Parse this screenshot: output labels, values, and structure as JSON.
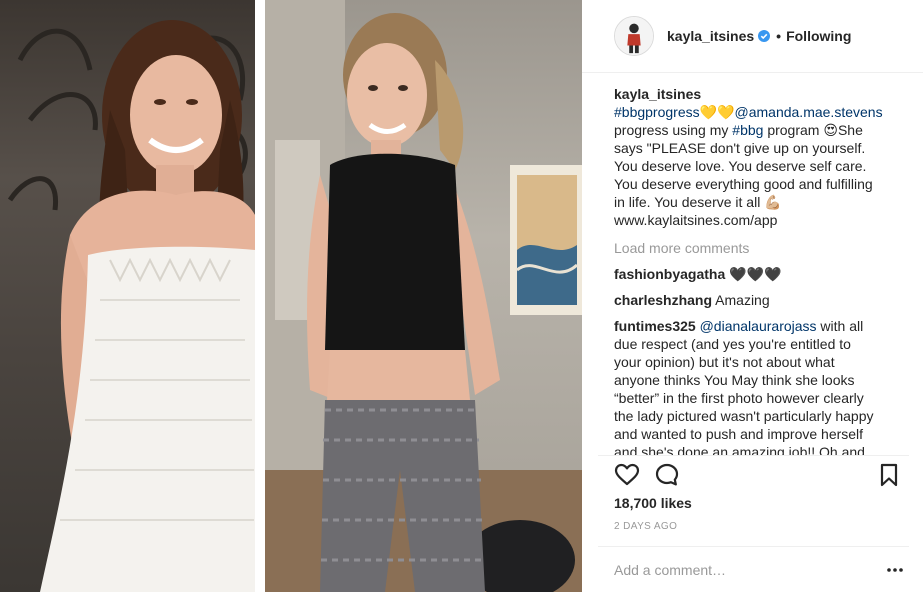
{
  "post": {
    "photo_left_alt": "",
    "photo_right_alt": ""
  },
  "header": {
    "username": "kayla_itsines",
    "separator": "•",
    "follow_label": "Following",
    "avatar_icon": "avatar-icon",
    "verified_icon": "verified-badge-icon"
  },
  "caption": {
    "username": "kayla_itsines",
    "line1_tag": "#bbgprogress",
    "line1_emoji": "💛💛",
    "line1_mention": "@amanda.mae.stevens",
    "line2_a": "progress using my ",
    "line2_tag": "#bbg",
    "line2_b": " program ",
    "line2_emoji": "😍",
    "line2_c": "She",
    "line3": "says \"PLEASE don't give up on yourself.",
    "line4": "You deserve love. You deserve self care.",
    "line5": "You deserve everything good and fulfilling",
    "line6_a": "in life. You deserve it all ",
    "line6_emoji": "💪🏼",
    "line7": "www.kaylaitsines.com/app"
  },
  "load_more": "Load more comments",
  "comments": [
    {
      "username": "fashionbyagatha",
      "text": "🖤🖤🖤"
    },
    {
      "username": "charleshzhang",
      "text": "Amazing"
    },
    {
      "username": "funtimes325",
      "mention": "@dianalaurarojass",
      "lines": [
        " with all",
        "due respect (and yes you're entitled to",
        "your opinion) but it's not about what",
        "anyone thinks You May think she looks",
        "“better” in the first photo however clearly",
        "the lady pictured wasn't particularly happy",
        "and wanted to push and improve herself",
        "and she's done an amazing job!! Oh and"
      ]
    }
  ],
  "actions": {
    "like_icon": "heart-icon",
    "comment_icon": "comment-icon",
    "save_icon": "bookmark-icon"
  },
  "likes": "18,700 likes",
  "date": "2 DAYS AGO",
  "add_comment_placeholder": "Add a comment…",
  "more_icon": "more-options-icon",
  "colors": {
    "link": "#003569",
    "muted": "#999999",
    "text": "#262626",
    "verified": "#3897f0"
  }
}
